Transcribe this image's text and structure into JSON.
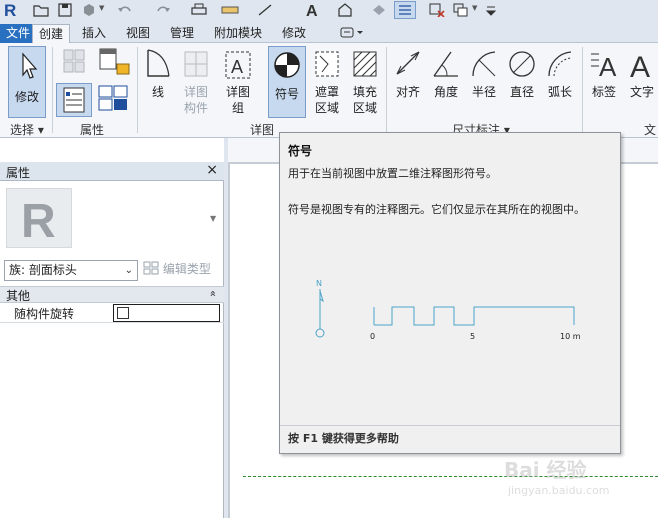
{
  "quick_access": {
    "icons": [
      "revit-logo-icon",
      "open-icon",
      "save-icon",
      "sync-icon",
      "undo-icon",
      "redo-icon",
      "print-icon",
      "measure-icon",
      "dimension-icon",
      "text-icon",
      "3d-view-icon",
      "tag-icon",
      "thin-lines-icon",
      "close-hidden-icon",
      "switch-windows-icon",
      "customize-icon"
    ]
  },
  "tabs": [
    {
      "label": "文件",
      "state": "file"
    },
    {
      "label": "创建",
      "state": "active"
    },
    {
      "label": "插入",
      "state": "normal"
    },
    {
      "label": "视图",
      "state": "normal"
    },
    {
      "label": "管理",
      "state": "normal"
    },
    {
      "label": "附加模块",
      "state": "normal"
    },
    {
      "label": "修改",
      "state": "normal"
    }
  ],
  "ribbon": {
    "modify_label": "修改",
    "select_group": "选择",
    "properties_group": "属性",
    "line_label": "线",
    "detail_component_label1": "详图",
    "detail_component_label2": "构件",
    "detail_group_label1": "详图",
    "detail_group_label2": "组",
    "symbol_label": "符号",
    "masking_label1": "遮罩",
    "masking_label2": "区域",
    "filled_label1": "填充",
    "filled_label2": "区域",
    "detail_panel": "详图",
    "aligned_label": "对齐",
    "angular_label": "角度",
    "radial_label": "半径",
    "diameter_label": "直径",
    "arc_label": "弧长",
    "dimension_panel": "尺寸标注",
    "tag_label": "标签",
    "text_label": "文字",
    "text_panel": "文"
  },
  "properties": {
    "title": "属性",
    "close": "×",
    "family_select": "族: 剖面标头",
    "edit_type": "编辑类型",
    "section": "其他",
    "collapse": "»",
    "param_name": "随构件旋转",
    "param_checked": false
  },
  "tooltip": {
    "title": "符号",
    "desc1": "用于在当前视图中放置二维注释图形符号。",
    "desc2": "符号是视图专有的注释图元。它们仅显示在其所在的视图中。",
    "scale_labels": [
      "0",
      "5",
      "10 m"
    ],
    "north": "N",
    "footer": "按 F1 键获得更多帮助"
  },
  "watermark": {
    "line1": "Bai 经验",
    "line2": "jingyan.baidu.com"
  },
  "colors": {
    "accent_blue": "#2a70c0",
    "tooltip_bg": "#f0f0f0",
    "section_line": "#2a8a2a"
  }
}
